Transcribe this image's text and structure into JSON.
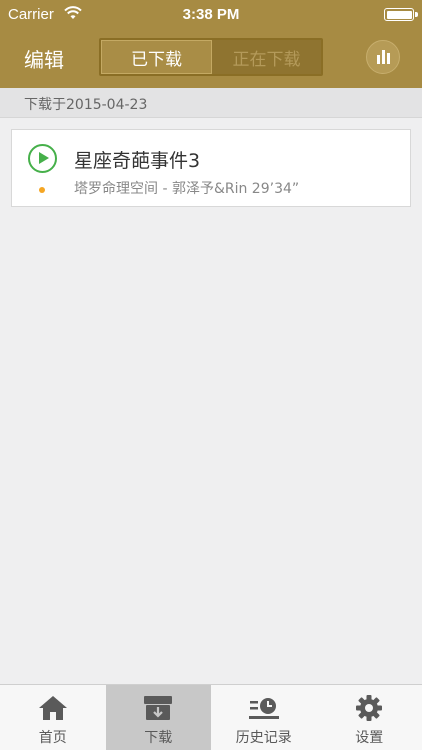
{
  "status_bar": {
    "carrier": "Carrier",
    "time": "3:38 PM"
  },
  "nav": {
    "edit_label": "编辑",
    "segments": [
      {
        "label": "已下载",
        "active": true
      },
      {
        "label": "正在下载",
        "active": false
      }
    ],
    "stats_icon": "bar-chart-icon"
  },
  "section": {
    "header": "下载于2015-04-23"
  },
  "downloads": [
    {
      "title": "星座奇葩事件3",
      "subtitle": "塔罗命理空间 - 郭泽予&Rin  29’34”",
      "status_dot_color": "#f5a623"
    }
  ],
  "tabbar": {
    "tabs": [
      {
        "label": "首页",
        "icon": "home-icon",
        "active": false
      },
      {
        "label": "下载",
        "icon": "download-box-icon",
        "active": true
      },
      {
        "label": "历史记录",
        "icon": "history-icon",
        "active": false
      },
      {
        "label": "设置",
        "icon": "gear-icon",
        "active": false
      }
    ]
  },
  "colors": {
    "brand": "#a78b43",
    "play": "#46b04a",
    "dot": "#f5a623"
  }
}
